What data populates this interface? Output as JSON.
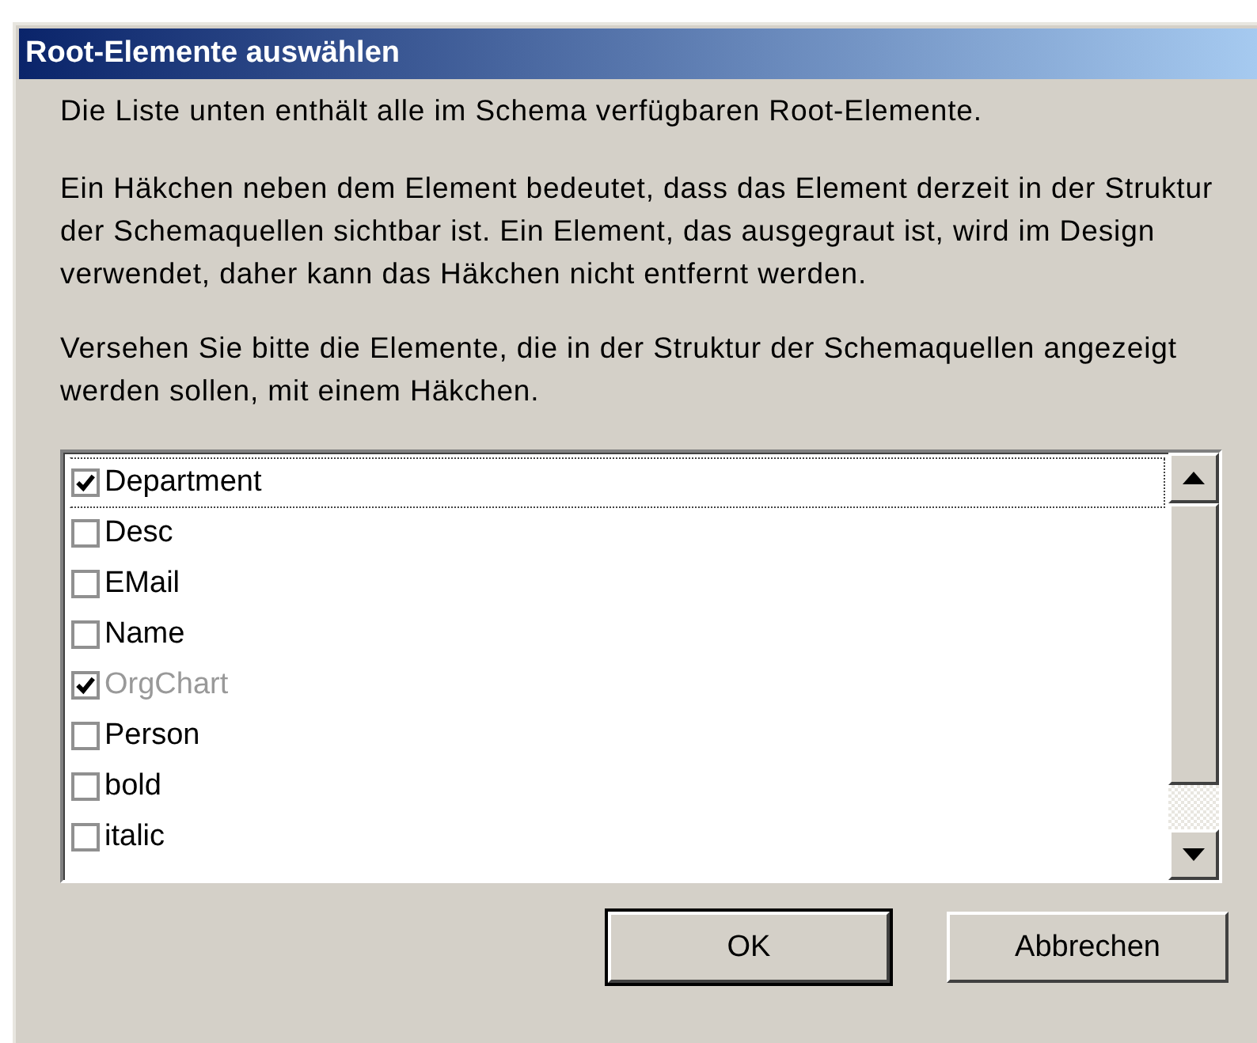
{
  "window": {
    "title": "Root-Elemente auswählen"
  },
  "paragraphs": [
    "Die Liste unten enthält alle im Schema verfügbaren Root-Elemente.",
    "Ein Häkchen neben dem Element bedeutet, dass das Element derzeit in der Struktur der Schemaquellen sichtbar ist. Ein Element, das ausgegraut ist, wird im Design verwendet, daher kann das Häkchen nicht entfernt werden.",
    "Versehen Sie bitte die Elemente, die in der Struktur der Schemaquellen angezeigt werden sollen, mit einem Häkchen."
  ],
  "items": [
    {
      "label": "Department",
      "checked": true,
      "disabled": false,
      "focused": true
    },
    {
      "label": "Desc",
      "checked": false,
      "disabled": false,
      "focused": false
    },
    {
      "label": "EMail",
      "checked": false,
      "disabled": false,
      "focused": false
    },
    {
      "label": "Name",
      "checked": false,
      "disabled": false,
      "focused": false
    },
    {
      "label": "OrgChart",
      "checked": true,
      "disabled": true,
      "focused": false
    },
    {
      "label": "Person",
      "checked": false,
      "disabled": false,
      "focused": false
    },
    {
      "label": "bold",
      "checked": false,
      "disabled": false,
      "focused": false
    },
    {
      "label": "italic",
      "checked": false,
      "disabled": false,
      "focused": false
    }
  ],
  "buttons": [
    {
      "label": "OK",
      "default": true
    },
    {
      "label": "Abbrechen",
      "default": false
    }
  ]
}
